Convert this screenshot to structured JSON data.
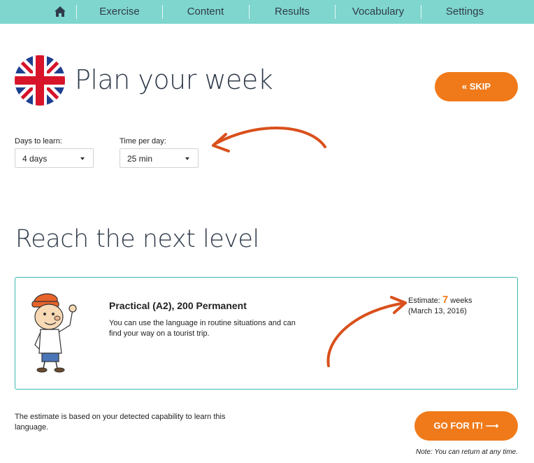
{
  "nav": {
    "home_icon": "home-icon",
    "items": [
      "Exercise",
      "Content",
      "Results",
      "Vocabulary",
      "Settings"
    ]
  },
  "header": {
    "flag_icon": "uk-flag-icon",
    "title": "Plan your week",
    "skip_label": "« SKIP"
  },
  "plan": {
    "days_label": "Days to learn:",
    "days_value": "4 days",
    "time_label": "Time per day:",
    "time_value": "25 min"
  },
  "level": {
    "heading": "Reach the next level",
    "title": "Practical (A2), 200 Permanent",
    "description": "You can use the language in routine situations and can find your way on a tourist trip.",
    "estimate_prefix": "Estimate: ",
    "estimate_number": "7",
    "estimate_suffix": " weeks",
    "estimate_date": "(March 13, 2016)"
  },
  "footer": {
    "info": "The estimate is based on your detected capability to learn this language.",
    "go_label": "GO FOR IT!  ⟶",
    "note": "Note: You can return at any time."
  },
  "colors": {
    "navbar": "#7fd6ce",
    "accent": "#f07a1a",
    "card_border": "#3db9ae",
    "arrow": "#d9501c"
  }
}
